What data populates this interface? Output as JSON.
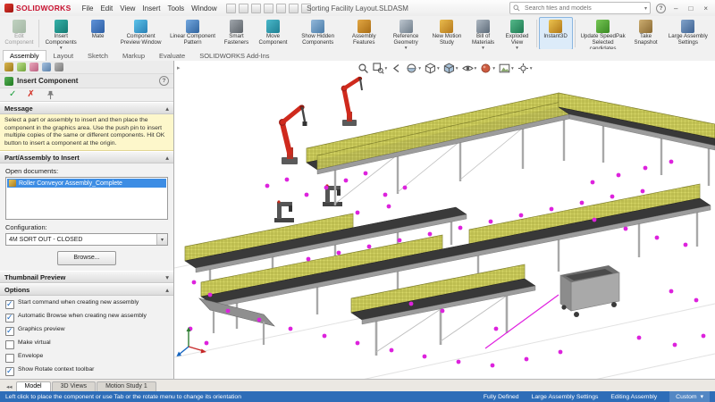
{
  "icons": {
    "ok": "✓",
    "cancel": "✗",
    "dropdown": "▾",
    "help": "?",
    "minimize": "–",
    "maximize": "□",
    "close": "×",
    "scroll_tabs": "◂◂",
    "tree_flyout": "▸",
    "collapse_up": "▴",
    "collapse_down": "▾"
  },
  "titlebar": {
    "brand": "SOLIDWORKS",
    "menus": [
      "File",
      "Edit",
      "View",
      "Insert",
      "Tools",
      "Window"
    ],
    "title": "Sorting Facility Layout.SLDASM",
    "search_placeholder": "Search files and models"
  },
  "ribbon": {
    "buttons": [
      {
        "label": "Edit Component",
        "disabled": true
      },
      {
        "label": "Insert Components"
      },
      {
        "label": "Mate"
      },
      {
        "label": "Component Preview Window"
      },
      {
        "label": "Linear Component Pattern"
      },
      {
        "label": "Smart Fasteners"
      },
      {
        "label": "Move Component"
      },
      {
        "label": "Show Hidden Components"
      },
      {
        "label": "Assembly Features"
      },
      {
        "label": "Reference Geometry"
      },
      {
        "label": "New Motion Study"
      },
      {
        "label": "Bill of Materials"
      },
      {
        "label": "Exploded View"
      },
      {
        "label": "Instant3D",
        "active": true
      },
      {
        "label": "Update SpeedPak Selected candidates"
      },
      {
        "label": "Take Snapshot"
      },
      {
        "label": "Large Assembly Settings"
      }
    ]
  },
  "command_tabs": [
    {
      "label": "Assembly",
      "active": true
    },
    {
      "label": "Layout"
    },
    {
      "label": "Sketch"
    },
    {
      "label": "Markup"
    },
    {
      "label": "Evaluate"
    },
    {
      "label": "SOLIDWORKS Add-Ins"
    }
  ],
  "property_manager": {
    "title": "Insert Component",
    "sections": {
      "message": "Message",
      "part": "Part/Assembly to Insert",
      "thumbnail": "Thumbnail Preview",
      "options": "Options"
    },
    "message": "Select a part or assembly to insert and then place the component in the graphics area. Use the push pin to insert multiple copies of the same or different components. Hit OK button to insert a component at the origin.",
    "open_documents_label": "Open documents:",
    "documents": [
      {
        "name": "Roller Conveyor Assembly_Complete",
        "selected": true
      }
    ],
    "configuration_label": "Configuration:",
    "configuration_value": "4M SORT OUT - CLOSED",
    "browse_label": "Browse...",
    "options": [
      {
        "label": "Start command when creating new assembly",
        "checked": true
      },
      {
        "label": "Automatic Browse when creating new assembly",
        "checked": true
      },
      {
        "label": "Graphics preview",
        "checked": true
      },
      {
        "label": "Make virtual",
        "checked": false
      },
      {
        "label": "Envelope",
        "checked": false
      },
      {
        "label": "Show Rotate context toolbar",
        "checked": true
      }
    ]
  },
  "model_tabs": [
    {
      "label": "Model",
      "active": true
    },
    {
      "label": "3D Views"
    },
    {
      "label": "Motion Study 1"
    }
  ],
  "statusbar": {
    "hint": "Left click to place the component or use Tab or the rotate menu to change its orientation",
    "items": [
      "Fully Defined",
      "Large Assembly Settings",
      "Editing Assembly"
    ],
    "units": "Custom"
  }
}
